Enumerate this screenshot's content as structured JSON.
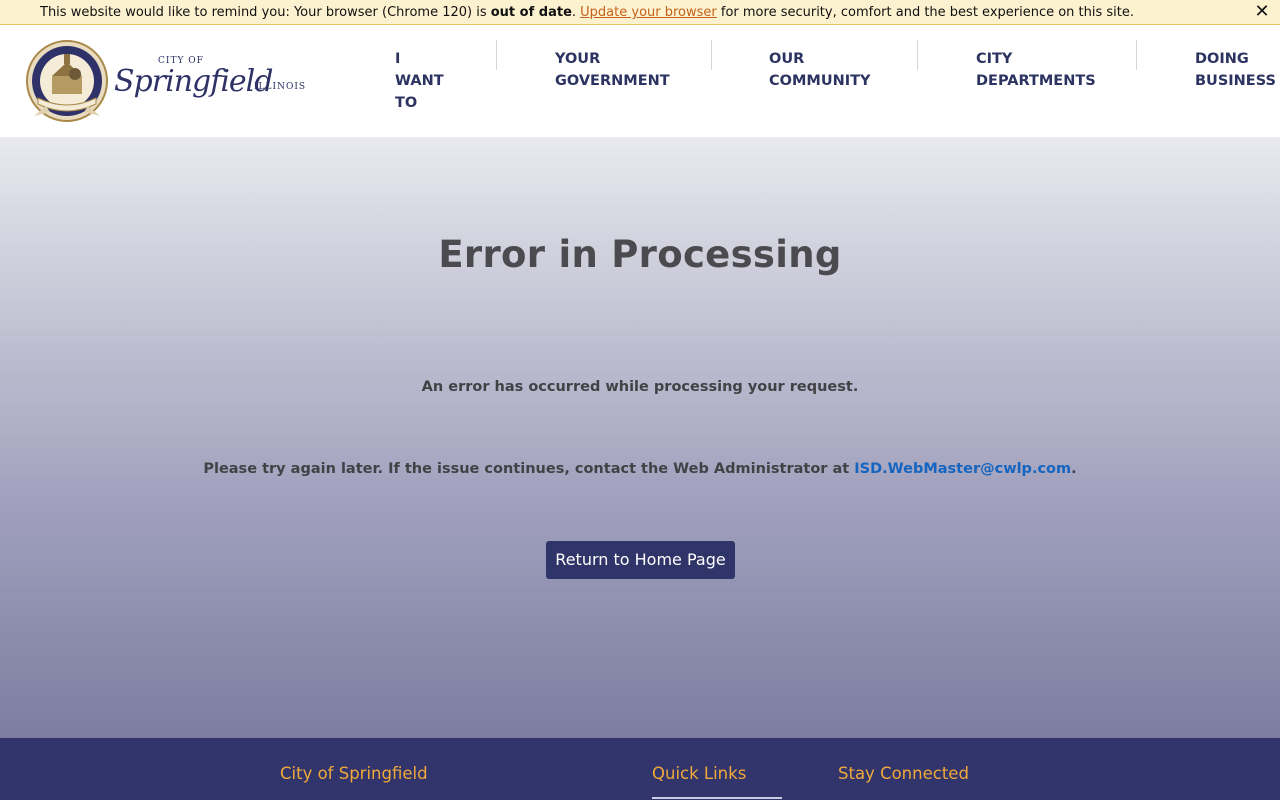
{
  "banner": {
    "text_before": "This website would like to remind you: Your browser (Chrome 120) is ",
    "bold": "out of date",
    "text_mid": ". ",
    "link": "Update your browser",
    "text_after": " for more security, comfort and the best experience on this site.",
    "close": "✕"
  },
  "logo": {
    "city_of": "CITY OF",
    "springfield": "Springfield",
    "state": "ILLINOIS",
    "seal_text": "CITY OF SPRINGFIELD, CAPITAL OF ILLINOIS · HOME OF LINCOLN · 1840"
  },
  "nav": {
    "items": [
      {
        "label_lines": [
          "I",
          "WANT",
          "TO"
        ]
      },
      {
        "label_lines": [
          "YOUR",
          "GOVERNMENT"
        ]
      },
      {
        "label_lines": [
          "OUR",
          "COMMUNITY"
        ]
      },
      {
        "label_lines": [
          "CITY",
          "DEPARTMENTS"
        ]
      },
      {
        "label_lines": [
          "DOING",
          "BUSINESS"
        ]
      }
    ]
  },
  "error": {
    "title": "Error in Processing",
    "message": "An error has occurred while processing your request.",
    "contact_text": "Please try again later. If the issue continues, contact the Web Administrator at ",
    "contact_email": "ISD.WebMaster@cwlp.com",
    "contact_end": ".",
    "button": "Return to Home Page"
  },
  "footer": {
    "col1": "City of Springfield",
    "col2": "Quick Links",
    "col3": "Stay Connected"
  },
  "colors": {
    "navy": "#2f3569",
    "footer_bg": "#32356b",
    "footer_heading": "#f0a83a",
    "link_blue": "#1565c0",
    "banner_bg": "#fdf2d0"
  }
}
